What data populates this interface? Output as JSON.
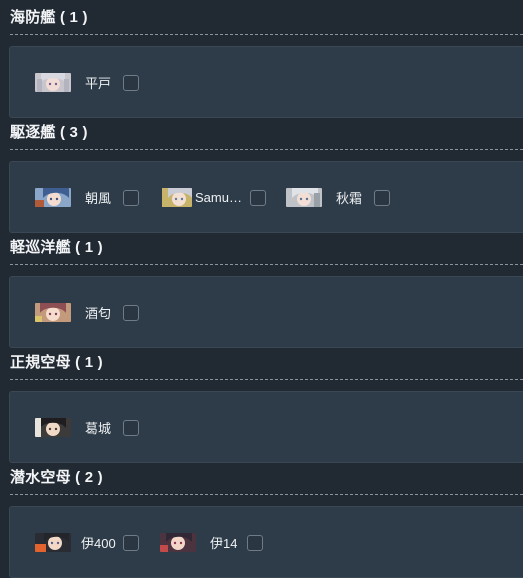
{
  "colors": {
    "background": "#212932",
    "panel": "#2e3b48",
    "divider": "#8a949e",
    "text": "#eef1f3"
  },
  "groups": [
    {
      "title": "海防艦 ( 1 )",
      "ships": [
        {
          "name": "平戸",
          "checked": false,
          "portrait": "ship-portrait-hirado"
        }
      ]
    },
    {
      "title": "駆逐艦 ( 3 )",
      "ships": [
        {
          "name": "朝風",
          "checked": false,
          "portrait": "ship-portrait-asakaze"
        },
        {
          "name": "Samue…",
          "checked": false,
          "portrait": "ship-portrait-samuel"
        },
        {
          "name": "秋霜",
          "checked": false,
          "portrait": "ship-portrait-akishimo"
        }
      ]
    },
    {
      "title": "軽巡洋艦 ( 1 )",
      "ships": [
        {
          "name": "酒匂",
          "checked": false,
          "portrait": "ship-portrait-sakawa"
        }
      ]
    },
    {
      "title": "正規空母 ( 1 )",
      "ships": [
        {
          "name": "葛城",
          "checked": false,
          "portrait": "ship-portrait-katsuragi"
        }
      ]
    },
    {
      "title": "潜水空母 ( 2 )",
      "ships": [
        {
          "name": "伊400",
          "checked": false,
          "portrait": "ship-portrait-i400"
        },
        {
          "name": "伊14",
          "checked": false,
          "portrait": "ship-portrait-i14"
        }
      ]
    }
  ]
}
